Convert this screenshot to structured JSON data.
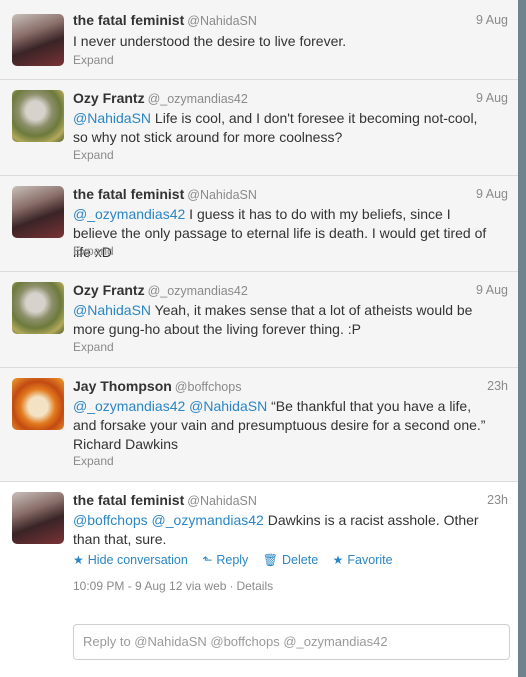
{
  "tweets": [
    {
      "name": "the fatal feminist",
      "handle": "@NahidaSN",
      "time": "9 Aug",
      "mentions": "",
      "body": "I never understood the desire to live forever.",
      "body2": "",
      "expand": "Expand",
      "avatar": "user-avatar"
    },
    {
      "name": "Ozy Frantz",
      "handle": "@_ozymandias42",
      "time": "9 Aug",
      "mentions": "@NahidaSN",
      "body": " Life is cool, and I don't foresee it becoming not-cool, so why not stick around for more coolness?",
      "body2": "",
      "expand": "Expand",
      "avatar": "user-avatar"
    },
    {
      "name": "the fatal feminist",
      "handle": "@NahidaSN",
      "time": "9 Aug",
      "mentions": "@_ozymandias42",
      "body": " I guess it has to do with my beliefs, since I believe the only passage to eternal life is death. I would get tired of life xD",
      "body2": "",
      "expand": "Expand",
      "avatar": "user-avatar"
    },
    {
      "name": "Ozy Frantz",
      "handle": "@_ozymandias42",
      "time": "9 Aug",
      "mentions": "@NahidaSN",
      "body": " Yeah, it makes sense that a lot of atheists would be more gung-ho about the living forever thing. :P",
      "body2": "",
      "expand": "Expand",
      "avatar": "user-avatar"
    },
    {
      "name": "Jay Thompson",
      "handle": "@boffchops",
      "time": "23h",
      "mentions": "@_ozymandias42 @NahidaSN",
      "body": " “Be thankful that you have a life, and forsake your vain and presumptuous desire for a second one.” Richard Dawkins",
      "body2": "",
      "expand": "Expand",
      "avatar": "user-avatar"
    },
    {
      "name": "the fatal feminist",
      "handle": "@NahidaSN",
      "time": "23h",
      "mentions": "@boffchops @_ozymandias42",
      "body": " Dawkins is a racist asshole. Other than that, sure.",
      "body2": "",
      "expand": "",
      "avatar": "user-avatar"
    }
  ],
  "actions": {
    "hide": "Hide conversation",
    "reply": "Reply",
    "delete": "Delete",
    "favorite": "Favorite",
    "hide_icon": "star-icon",
    "reply_icon": "reply-arrow-icon",
    "delete_icon": "trash-icon",
    "favorite_icon": "star-icon"
  },
  "meta": {
    "time": "10:09 PM - 9 Aug 12",
    "via": "via web",
    "sep": "·",
    "details": "Details"
  },
  "reply": {
    "placeholder": "Reply to @NahidaSN @boffchops @_ozymandias42"
  },
  "colors": {
    "link": "#2a86c4",
    "muted": "#8a8a8a",
    "text": "#333333",
    "panel": "#f5f5f5"
  }
}
